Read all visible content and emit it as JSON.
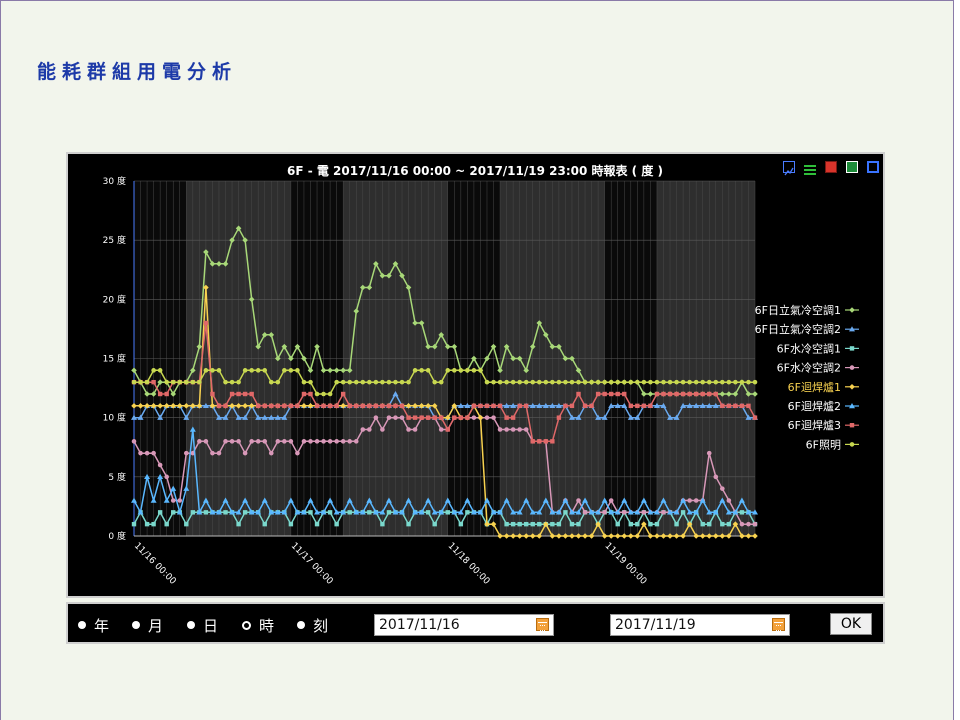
{
  "page": {
    "title": "能耗群組用電分析"
  },
  "toolbar": {
    "icons": [
      "line-chart-icon",
      "table-icon",
      "print-icon",
      "excel-icon",
      "save-icon"
    ]
  },
  "controls": {
    "radios": [
      {
        "label": "年",
        "selected": false
      },
      {
        "label": "月",
        "selected": false
      },
      {
        "label": "日",
        "selected": false
      },
      {
        "label": "時",
        "selected": true
      },
      {
        "label": "刻",
        "selected": false
      }
    ],
    "start_date": "2017/11/16",
    "end_date": "2017/11/19",
    "ok_label": "OK"
  },
  "chart_data": {
    "type": "line",
    "title": "6F - 電 2017/11/16 00:00 ~ 2017/11/19 23:00 時報表 ( 度 )",
    "ylim": [
      0,
      30
    ],
    "yticks": [
      0,
      5,
      10,
      15,
      20,
      25,
      30
    ],
    "ytick_labels": [
      "0 度",
      "5 度",
      "10 度",
      "15 度",
      "20 度",
      "25 度",
      "30 度"
    ],
    "xtick_labels": [
      "11/16 00:00",
      "11/17 00:00",
      "11/18 00:00",
      "11/19 00:00"
    ],
    "x_hours": 96,
    "grid": true,
    "legend_position": "right",
    "series": [
      {
        "name": "6F日立氣冷空調1",
        "color": "#a8d878",
        "marker": "diamond",
        "values": [
          14,
          13,
          12,
          12,
          13,
          13,
          12,
          13,
          13,
          14,
          16,
          24,
          23,
          23,
          23,
          25,
          26,
          25,
          20,
          16,
          17,
          17,
          15,
          16,
          15,
          16,
          15,
          14,
          16,
          14,
          14,
          14,
          14,
          14,
          19,
          21,
          21,
          23,
          22,
          22,
          23,
          22,
          21,
          18,
          18,
          16,
          16,
          17,
          16,
          16,
          14,
          14,
          15,
          14,
          15,
          16,
          14,
          16,
          15,
          15,
          14,
          16,
          18,
          17,
          16,
          16,
          15,
          15,
          14,
          13,
          13,
          13,
          13,
          13,
          13,
          13,
          13,
          13,
          12,
          12,
          12,
          12,
          12,
          12,
          12,
          12,
          12,
          12,
          12,
          12,
          12,
          12,
          12,
          13,
          12,
          12
        ]
      },
      {
        "name": "6F日立氣冷空調2",
        "color": "#6aaaf0",
        "marker": "triangle",
        "values": [
          10,
          10,
          11,
          11,
          10,
          11,
          11,
          11,
          10,
          11,
          11,
          11,
          11,
          10,
          10,
          11,
          10,
          10,
          11,
          10,
          10,
          10,
          10,
          10,
          11,
          11,
          11,
          11,
          11,
          11,
          11,
          11,
          11,
          11,
          11,
          11,
          11,
          11,
          11,
          11,
          12,
          11,
          11,
          11,
          11,
          11,
          10,
          10,
          10,
          11,
          11,
          11,
          11,
          11,
          11,
          11,
          11,
          11,
          11,
          11,
          11,
          11,
          11,
          11,
          11,
          11,
          11,
          10,
          10,
          11,
          11,
          10,
          10,
          11,
          11,
          11,
          10,
          10,
          11,
          11,
          11,
          11,
          10,
          10,
          11,
          11,
          11,
          11,
          11,
          11,
          11,
          11,
          11,
          11,
          10,
          10
        ]
      },
      {
        "name": "6F水冷空調1",
        "color": "#7ad8cc",
        "marker": "square",
        "values": [
          1,
          2,
          1,
          1,
          2,
          1,
          2,
          2,
          1,
          2,
          2,
          2,
          2,
          2,
          2,
          2,
          1,
          2,
          2,
          2,
          1,
          2,
          2,
          2,
          1,
          2,
          2,
          2,
          1,
          2,
          2,
          1,
          2,
          2,
          2,
          2,
          2,
          2,
          1,
          2,
          2,
          2,
          1,
          2,
          2,
          2,
          1,
          2,
          2,
          2,
          1,
          2,
          2,
          2,
          1,
          2,
          2,
          1,
          1,
          1,
          1,
          1,
          1,
          1,
          1,
          1,
          2,
          1,
          1,
          2,
          2,
          1,
          2,
          2,
          1,
          2,
          1,
          1,
          2,
          1,
          1,
          2,
          2,
          1,
          2,
          1,
          2,
          1,
          1,
          2,
          1,
          1,
          2,
          2,
          2,
          1
        ]
      },
      {
        "name": "6F水冷空調2",
        "color": "#d898b8",
        "marker": "circle",
        "values": [
          8,
          7,
          7,
          7,
          6,
          5,
          3,
          3,
          7,
          7,
          8,
          8,
          7,
          7,
          8,
          8,
          8,
          7,
          8,
          8,
          8,
          7,
          8,
          8,
          8,
          7,
          8,
          8,
          8,
          8,
          8,
          8,
          8,
          8,
          8,
          9,
          9,
          10,
          9,
          10,
          10,
          10,
          9,
          9,
          10,
          10,
          10,
          9,
          9,
          10,
          10,
          10,
          10,
          10,
          10,
          10,
          9,
          9,
          9,
          9,
          9,
          8,
          8,
          8,
          2,
          2,
          3,
          2,
          3,
          2,
          2,
          2,
          2,
          3,
          2,
          2,
          2,
          2,
          2,
          2,
          2,
          2,
          2,
          2,
          3,
          3,
          3,
          3,
          7,
          5,
          4,
          3,
          2,
          1,
          1,
          1
        ]
      },
      {
        "name": "6F迴焊爐1",
        "color": "#f8d250",
        "marker": "diamond",
        "values": [
          11,
          11,
          11,
          11,
          11,
          11,
          11,
          11,
          11,
          11,
          11,
          21,
          11,
          11,
          11,
          11,
          11,
          11,
          11,
          11,
          11,
          11,
          11,
          11,
          11,
          11,
          11,
          11,
          11,
          11,
          11,
          11,
          11,
          11,
          11,
          11,
          11,
          11,
          11,
          11,
          11,
          11,
          11,
          11,
          11,
          11,
          11,
          10,
          10,
          11,
          10,
          10,
          11,
          10,
          1,
          1,
          0,
          0,
          0,
          0,
          0,
          0,
          0,
          1,
          0,
          0,
          0,
          0,
          0,
          0,
          0,
          1,
          0,
          0,
          0,
          0,
          0,
          0,
          1,
          0,
          0,
          0,
          0,
          0,
          0,
          1,
          0,
          0,
          0,
          0,
          0,
          0,
          1,
          0,
          0,
          0
        ]
      },
      {
        "name": "6F迴焊爐2",
        "color": "#5ab8ff",
        "marker": "triangle",
        "values": [
          3,
          2,
          5,
          3,
          5,
          3,
          4,
          2,
          4,
          9,
          2,
          3,
          2,
          2,
          3,
          2,
          2,
          3,
          2,
          2,
          3,
          2,
          2,
          2,
          3,
          2,
          2,
          3,
          2,
          2,
          3,
          2,
          2,
          3,
          2,
          2,
          3,
          2,
          2,
          3,
          2,
          2,
          3,
          2,
          2,
          3,
          2,
          2,
          3,
          2,
          2,
          3,
          2,
          2,
          3,
          2,
          2,
          3,
          2,
          2,
          3,
          2,
          2,
          3,
          2,
          2,
          3,
          2,
          2,
          3,
          2,
          2,
          3,
          2,
          2,
          3,
          2,
          2,
          3,
          2,
          2,
          3,
          2,
          2,
          3,
          2,
          2,
          3,
          2,
          2,
          3,
          2,
          2,
          3,
          2,
          2
        ]
      },
      {
        "name": "6F迴焊爐3",
        "color": "#e06868",
        "marker": "square",
        "values": [
          13,
          13,
          13,
          13,
          12,
          12,
          13,
          13,
          13,
          13,
          13,
          18,
          12,
          11,
          11,
          12,
          12,
          12,
          12,
          11,
          11,
          11,
          11,
          11,
          11,
          11,
          12,
          12,
          11,
          11,
          11,
          11,
          12,
          11,
          11,
          11,
          11,
          11,
          11,
          11,
          11,
          11,
          10,
          10,
          10,
          10,
          10,
          10,
          9,
          10,
          10,
          10,
          11,
          11,
          11,
          11,
          11,
          10,
          10,
          11,
          11,
          8,
          8,
          8,
          8,
          10,
          11,
          11,
          12,
          11,
          11,
          12,
          12,
          12,
          12,
          12,
          11,
          11,
          11,
          11,
          12,
          12,
          12,
          12,
          12,
          12,
          12,
          12,
          12,
          12,
          11,
          11,
          11,
          11,
          11,
          10
        ]
      },
      {
        "name": "6F照明",
        "color": "#c8d850",
        "marker": "circle",
        "values": [
          13,
          13,
          13,
          14,
          14,
          13,
          13,
          13,
          13,
          13,
          13,
          14,
          14,
          14,
          13,
          13,
          13,
          14,
          14,
          14,
          14,
          13,
          13,
          14,
          14,
          14,
          13,
          13,
          12,
          12,
          12,
          13,
          13,
          13,
          13,
          13,
          13,
          13,
          13,
          13,
          13,
          13,
          13,
          14,
          14,
          14,
          13,
          13,
          14,
          14,
          14,
          14,
          14,
          14,
          13,
          13,
          13,
          13,
          13,
          13,
          13,
          13,
          13,
          13,
          13,
          13,
          13,
          13,
          13,
          13,
          13,
          13,
          13,
          13,
          13,
          13,
          13,
          13,
          13,
          13,
          13,
          13,
          13,
          13,
          13,
          13,
          13,
          13,
          13,
          13,
          13,
          13,
          13,
          13,
          13,
          13
        ]
      }
    ]
  }
}
